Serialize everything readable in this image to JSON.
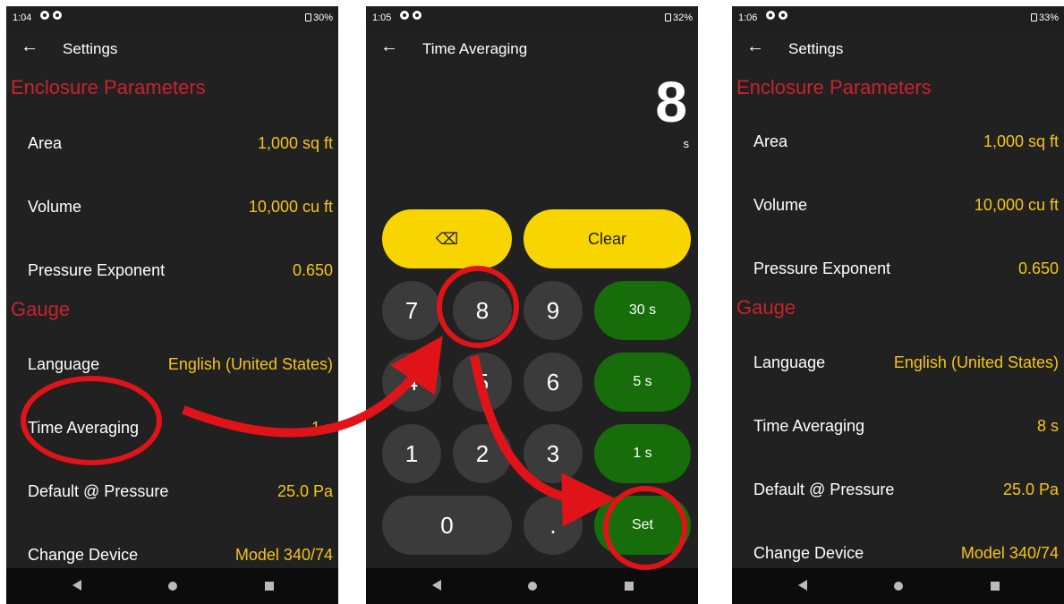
{
  "left": {
    "status": {
      "time": "1:04",
      "battery": "30%"
    },
    "title": "Settings",
    "sections": [
      {
        "name": "Enclosure Parameters",
        "rows": [
          {
            "label": "Area",
            "value": "1,000 sq ft"
          },
          {
            "label": "Volume",
            "value": "10,000 cu ft"
          },
          {
            "label": "Pressure Exponent",
            "value": "0.650"
          }
        ]
      },
      {
        "name": "Gauge",
        "rows": [
          {
            "label": "Language",
            "value": "English (United States)"
          },
          {
            "label": "Time Averaging",
            "value": "1 s"
          },
          {
            "label": "Default @ Pressure",
            "value": "25.0 Pa"
          },
          {
            "label": "Change Device",
            "value": "Model 340/74"
          }
        ]
      }
    ]
  },
  "middle": {
    "status": {
      "time": "1:05",
      "battery": "32%"
    },
    "title": "Time Averaging",
    "display_value": "8",
    "display_unit": "s",
    "keys": {
      "backspace": "⌫",
      "clear": "Clear",
      "k7": "7",
      "k8": "8",
      "k9": "9",
      "k4": "4",
      "k5": "5",
      "k6": "6",
      "k1": "1",
      "k2": "2",
      "k3": "3",
      "k0": "0",
      "dot": ".",
      "preset30": "30 s",
      "preset5": "5 s",
      "preset1": "1 s",
      "set": "Set"
    }
  },
  "right": {
    "status": {
      "time": "1:06",
      "battery": "33%"
    },
    "title": "Settings",
    "sections": [
      {
        "name": "Enclosure Parameters",
        "rows": [
          {
            "label": "Area",
            "value": "1,000 sq ft"
          },
          {
            "label": "Volume",
            "value": "10,000 cu ft"
          },
          {
            "label": "Pressure Exponent",
            "value": "0.650"
          }
        ]
      },
      {
        "name": "Gauge",
        "rows": [
          {
            "label": "Language",
            "value": "English (United States)"
          },
          {
            "label": "Time Averaging",
            "value": "8 s"
          },
          {
            "label": "Default @ Pressure",
            "value": "25.0 Pa"
          },
          {
            "label": "Change Device",
            "value": "Model 340/74"
          }
        ]
      }
    ]
  },
  "colors": {
    "section_header": "#c8232c",
    "value": "#f5c518",
    "accent_yellow": "#f9d500",
    "accent_green": "#166d0a",
    "highlight": "#e01418"
  }
}
